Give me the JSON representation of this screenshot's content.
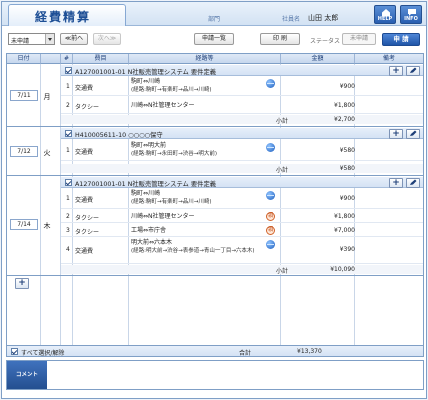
{
  "header": {
    "title": "経費精算",
    "dept_label": "部門",
    "employee_label": "社員名",
    "employee_name": "山田 太郎",
    "help_label": "HELP",
    "info_label": "INFO"
  },
  "toolbar": {
    "status_filter": "未申請",
    "prev_label": "≪前へ",
    "next_label": "次へ≫",
    "request_list_label": "申請一覧",
    "print_label": "印 刷",
    "status_label": "ステータス",
    "status_value": "未申請",
    "apply_label": "申 請"
  },
  "columns": {
    "date": "日付",
    "no": "#",
    "item": "費目",
    "route": "経路等",
    "amount": "金額",
    "remarks": "備考"
  },
  "days": [
    {
      "date": "7/11",
      "dow": "月",
      "group": "A127001001-01 N社販売管理システム 要件定義",
      "rows": [
        {
          "n": "1",
          "item": "交通費",
          "route": "駒町⇔川崎",
          "sub": "(経路:駒町→有楽町→品川→川崎)",
          "amount": "¥900",
          "icon": "globe"
        },
        {
          "n": "2",
          "item": "タクシー",
          "route": "川崎⇔N社管理センター",
          "sub": "",
          "amount": "¥1,800",
          "icon": ""
        }
      ],
      "subtotal_label": "小計",
      "subtotal": "¥2,700"
    },
    {
      "date": "7/12",
      "dow": "火",
      "group": "H410005611-10 ○○○○保守",
      "rows": [
        {
          "n": "1",
          "item": "交通費",
          "route": "駒町⇔明大前",
          "sub": "(経路:駒町→永田町→渋谷→明大前)",
          "amount": "¥580",
          "icon": "globe"
        }
      ],
      "subtotal_label": "小計",
      "subtotal": "¥580"
    },
    {
      "date": "7/14",
      "dow": "木",
      "group": "A127001001-01 N社販売管理システム 要件定義",
      "rows": [
        {
          "n": "1",
          "item": "交通費",
          "route": "駒町⇔川崎",
          "sub": "(経路:駒町→有楽町→品川→川崎)",
          "amount": "¥900",
          "icon": "globe"
        },
        {
          "n": "2",
          "item": "タクシー",
          "route": "川崎⇔N社管理センター",
          "sub": "",
          "amount": "¥1,800",
          "icon": "receipt"
        },
        {
          "n": "3",
          "item": "タクシー",
          "route": "工場⇔市庁舎",
          "sub": "",
          "amount": "¥7,000",
          "icon": "receipt"
        },
        {
          "n": "4",
          "item": "交通費",
          "route": "明大前⇔六本木",
          "sub": "(経路:明大前→渋谷→表参道→青山一丁目→六本木)",
          "amount": "¥390",
          "icon": "globe"
        }
      ],
      "subtotal_label": "小計",
      "subtotal": "¥10,090"
    }
  ],
  "footer": {
    "select_all_label": "すべて選択/解除",
    "total_label": "合計",
    "total_value": "¥13,370"
  },
  "comment": {
    "label": "コメント"
  },
  "icons": {
    "receipt_glyph": "領"
  }
}
